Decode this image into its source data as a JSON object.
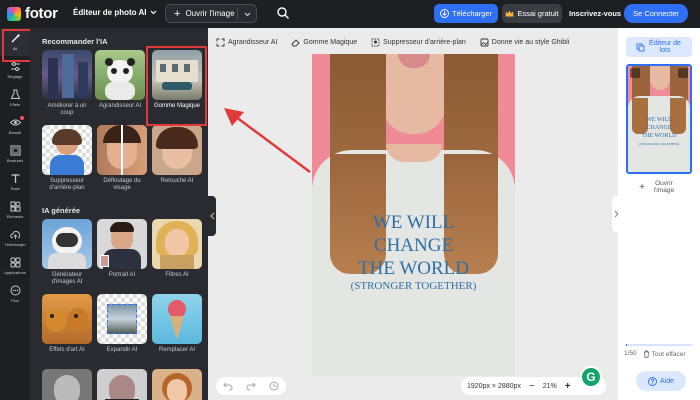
{
  "app": {
    "logo_text": "fotor",
    "editor_menu": "Éditeur de photo AI",
    "open_image": "Ouvrir l'image",
    "download": "Télécharger",
    "free_trial": "Essai gratuit",
    "signup": "Inscrivez-vous",
    "login": "Se Connecter"
  },
  "rail": [
    {
      "label": "AI"
    },
    {
      "label": "Réglage"
    },
    {
      "label": "Effets"
    },
    {
      "label": "Beauté"
    },
    {
      "label": "Bordures"
    },
    {
      "label": "Texte"
    },
    {
      "label": "Eléments"
    },
    {
      "label": "Télécharger"
    },
    {
      "label": "Applications"
    },
    {
      "label": "Plus"
    }
  ],
  "panel": {
    "recommended_title": "Recommander l'IA",
    "generated_title": "IA générée",
    "recommended": [
      {
        "label": "Améliorer à un coup"
      },
      {
        "label": "Agrandisseur AI"
      },
      {
        "label": "Gomme Magique"
      },
      {
        "label": "Suppresseur d'arrière-plan"
      },
      {
        "label": "Défloutage du visage"
      },
      {
        "label": "Retouche AI"
      }
    ],
    "generated": [
      {
        "label": "Générateur d'images AI"
      },
      {
        "label": "Portrait AI"
      },
      {
        "label": "Filtres AI"
      },
      {
        "label": "Effets d'art AI"
      },
      {
        "label": "Expandir AI"
      },
      {
        "label": "Remplacer AI"
      }
    ]
  },
  "ai_tools_bar": [
    {
      "label": "Agrandisseur AI"
    },
    {
      "label": "Gomme Magique"
    },
    {
      "label": "Suppresseur d'arrière-plan"
    },
    {
      "label": "Donne vie au style Ghibli"
    }
  ],
  "canvas": {
    "shirt_text": [
      "WE WILL",
      "CHANGE",
      "THE WORLD",
      "(STRONGER TOGETHER)"
    ],
    "dimensions": "1920px × 2880px",
    "zoom": "21%",
    "grammarly_letter": "G"
  },
  "right_panel": {
    "edit_lots": "Éditeur de lots",
    "open_image": "Ouvrir l'image",
    "count": "1/50",
    "clear_all": "Tout effacer",
    "help": "Aide",
    "progress": 0.02
  },
  "colors": {
    "accent": "#2f6ff5",
    "highlight": "#e03a3a",
    "dark_bg": "#1e1f23"
  }
}
